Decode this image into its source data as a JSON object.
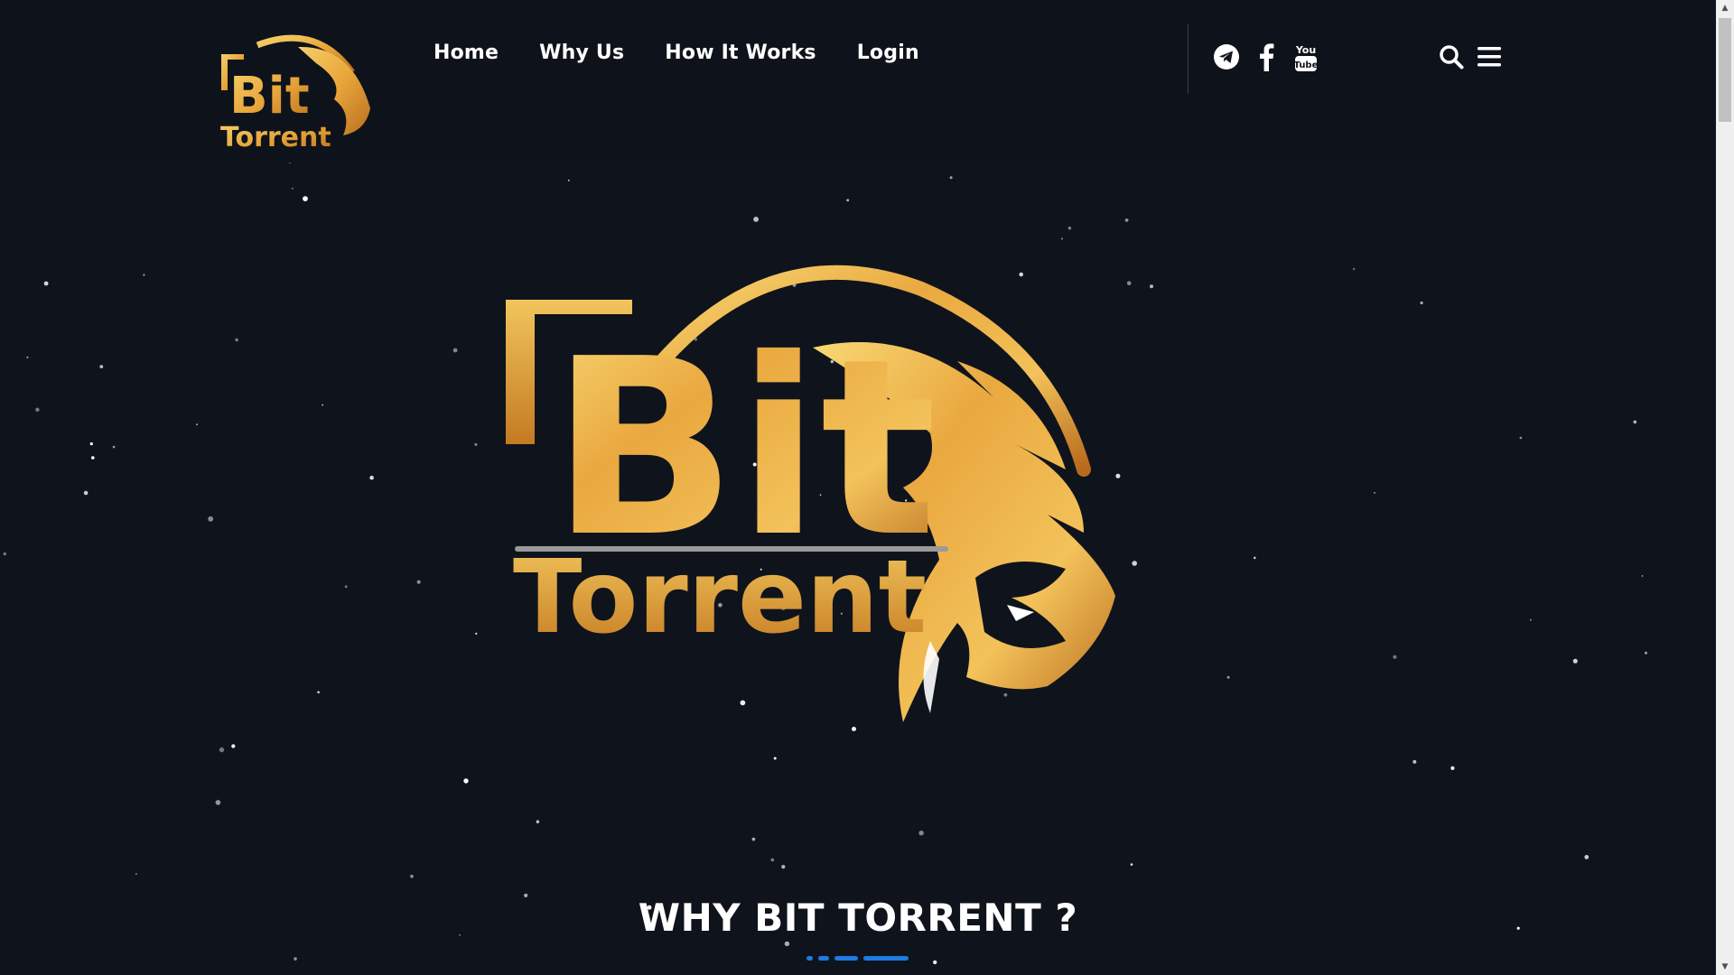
{
  "brand": {
    "name_line1": "Bit",
    "name_line2": "Torrent"
  },
  "nav": {
    "items": [
      {
        "label": "Home"
      },
      {
        "label": "Why Us"
      },
      {
        "label": "How It Works"
      },
      {
        "label": "Login"
      }
    ]
  },
  "social": {
    "icons": [
      "telegram-icon",
      "facebook-icon",
      "youtube-icon"
    ],
    "youtube_line1": "You",
    "youtube_line2": "Tube"
  },
  "tools": {
    "icons": [
      "search-icon",
      "hamburger-menu-icon"
    ]
  },
  "hero": {
    "logo_line1": "Bit",
    "logo_line2": "Torrent"
  },
  "section": {
    "title": "WHY BIT TORRENT ?"
  },
  "colors": {
    "background": "#0f141c",
    "gold": "#e8a63a",
    "gold_light": "#f6cf6a",
    "gold_dark": "#b96f1f",
    "accent_blue": "#1e7be0",
    "text": "#ffffff"
  }
}
